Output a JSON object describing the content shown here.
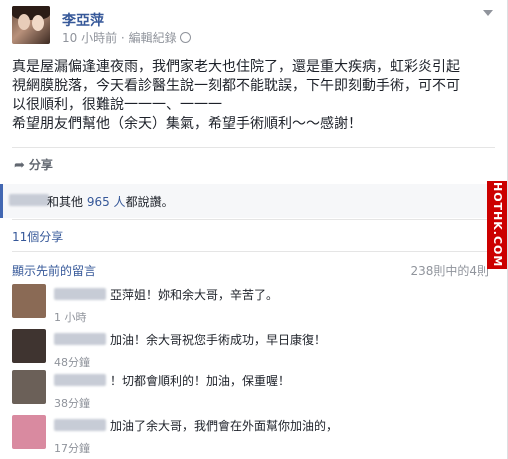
{
  "post": {
    "author": "李亞萍",
    "time": "10 小時前",
    "separator": "·",
    "edit_history": "編輯紀錄",
    "text_lines": [
      "真是屋漏偏逢連夜雨，我們家老大也住院了，還是重大疾病，虹彩炎引起",
      "視網膜脫落，今天看診醫生說一刻都不能耽誤，下午即刻動手術，可不可",
      "以很順利，很難說一一一、一一一",
      "希望朋友們幫他（余天）集氣，希望手術順利～～感謝！"
    ],
    "share_label": "分享"
  },
  "likes": {
    "prefix": "和其他 ",
    "count": "965 人",
    "suffix": "都說讚。"
  },
  "shares": "11個分享",
  "comments_section": {
    "show_previous": "顯示先前的留言",
    "count_text": "238則中的4則"
  },
  "watermark": "HOTHK.COM",
  "comments": [
    {
      "text": "亞萍姐！妳和余大哥，辛苦了。",
      "time": "1 小時",
      "avatar_color": "#8a6a55"
    },
    {
      "text": "加油！余大哥祝您手術成功，早日康復！",
      "time": "48分鐘",
      "avatar_color": "#3f3430"
    },
    {
      "text": "！切都會順利的！加油，保重喔！",
      "time": "38分鐘",
      "avatar_color": "#6b6058"
    },
    {
      "text": "加油了余大哥，我們會在外面幫你加油的，",
      "time": "17分鐘",
      "avatar_color": "#d98aa0"
    }
  ]
}
